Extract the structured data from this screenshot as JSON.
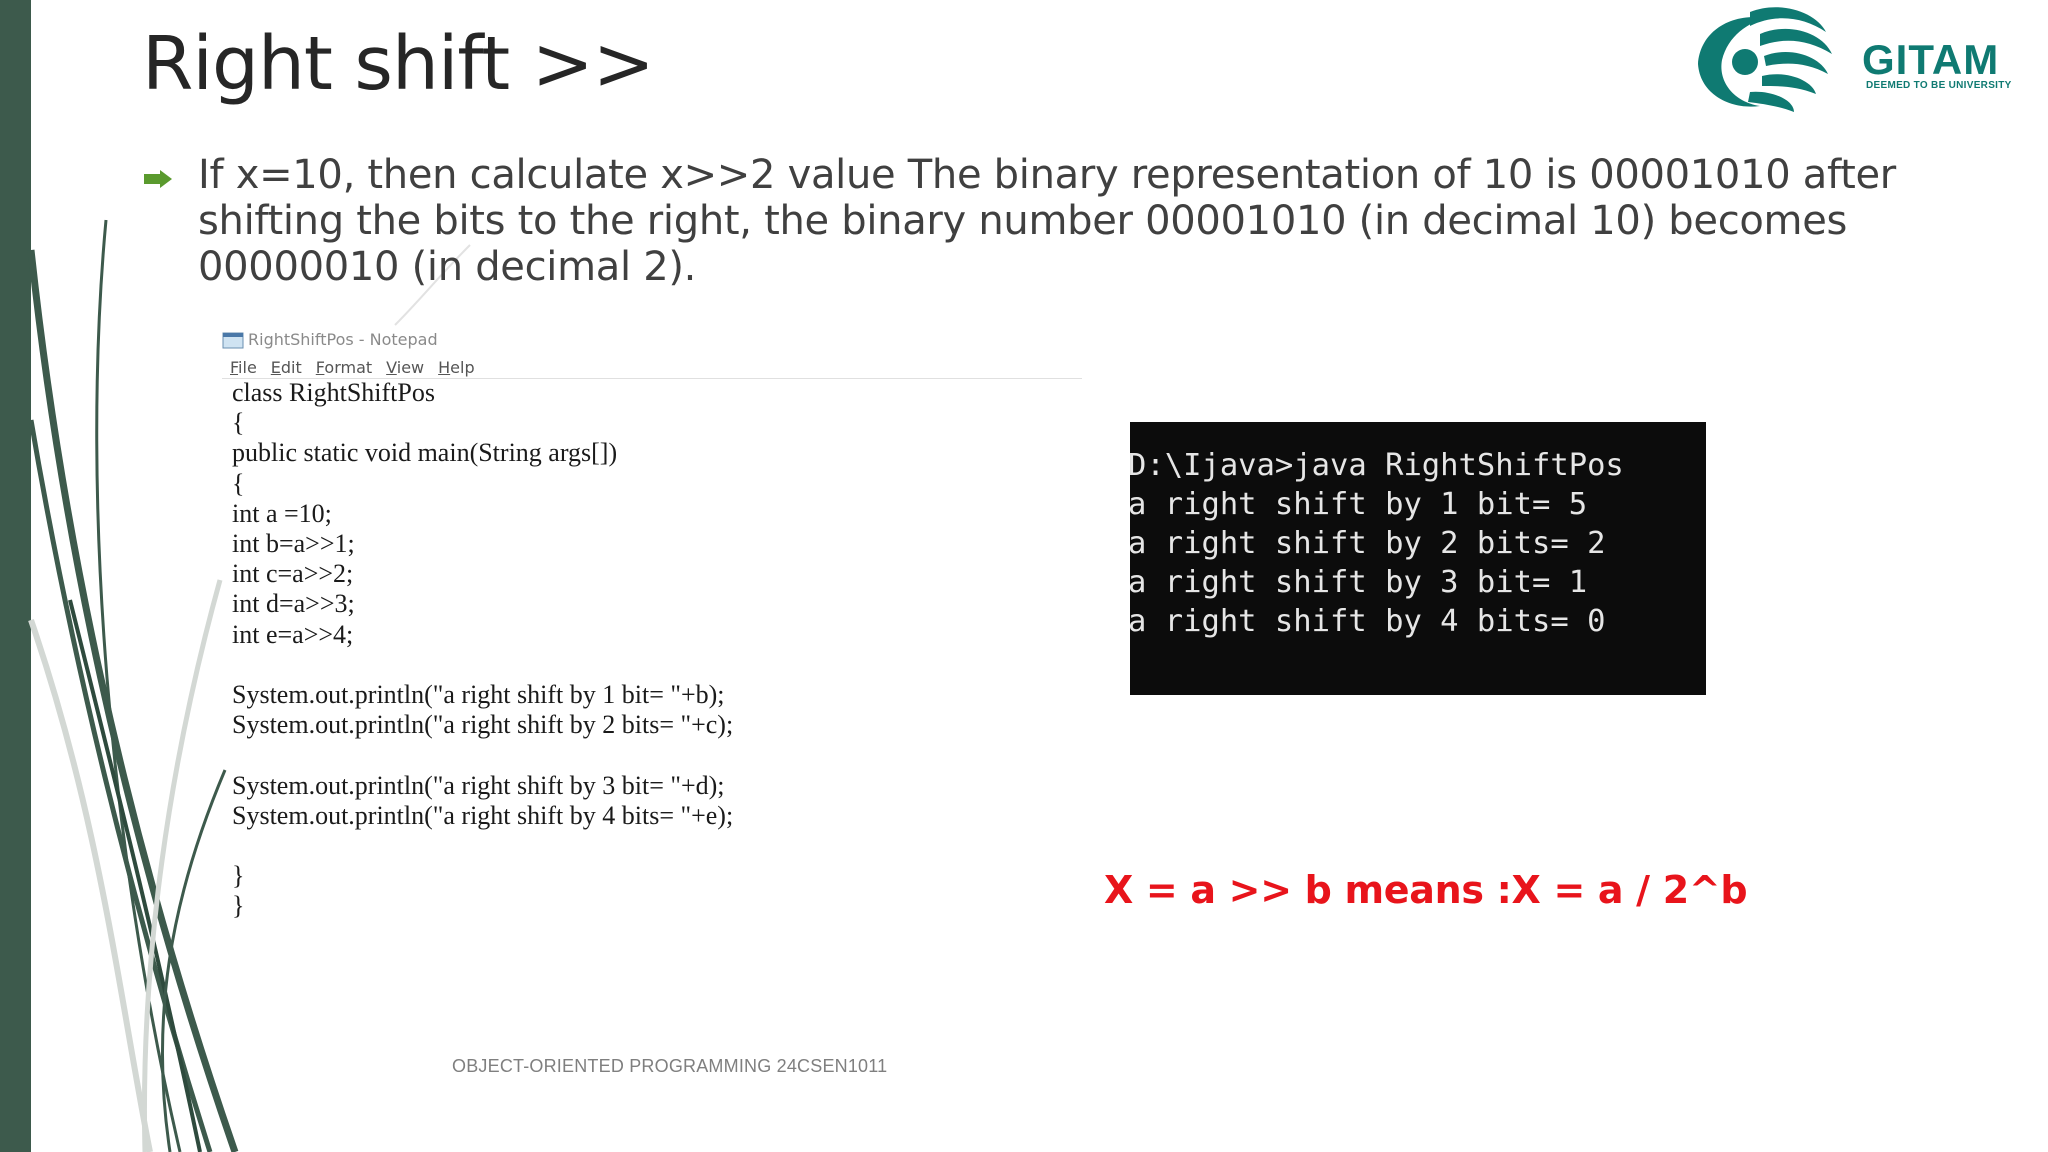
{
  "slide": {
    "title": "Right shift >>",
    "bullet": "If x=10, then calculate x>>2 value The binary representation of 10 is 00001010 after shifting the bits to the right, the binary number 00001010 (in decimal 10) becomes 00000010 (in decimal 2).",
    "bullet_icon": "arrow-right-icon",
    "formula": "X = a >> b means :X = a / 2^b",
    "footer": "OBJECT-ORIENTED PROGRAMMING  24CSEN1011"
  },
  "logo": {
    "name": "GITAM",
    "tagline": "DEEMED TO BE UNIVERSITY",
    "icon": "gitam-swirl-logo",
    "color": "#0f7a72"
  },
  "notepad": {
    "window_title": "RightShiftPos - Notepad",
    "icon": "notepad-icon",
    "menu": [
      "File",
      "Edit",
      "Format",
      "View",
      "Help"
    ],
    "code": "class RightShiftPos\n{\npublic static void main(String args[])\n{\nint a =10;\nint b=a>>1;\nint c=a>>2;\nint d=a>>3;\nint e=a>>4;\n\nSystem.out.println(\"a right shift by 1 bit= \"+b);\nSystem.out.println(\"a right shift by 2 bits= \"+c);\n\nSystem.out.println(\"a right shift by 3 bit= \"+d);\nSystem.out.println(\"a right shift by 4 bits= \"+e);\n\n}\n}"
  },
  "console": {
    "output": "D:\\Ijava>java RightShiftPos\na right shift by 1 bit= 5\na right shift by 2 bits= 2\na right shift by 3 bit= 1\na right shift by 4 bits= 0"
  },
  "colors": {
    "sidebar": "#3d5a4c",
    "title": "#262626",
    "bullet_arrow": "#5a9a2e",
    "formula": "#e8141b",
    "console_bg": "#0c0c0c"
  }
}
